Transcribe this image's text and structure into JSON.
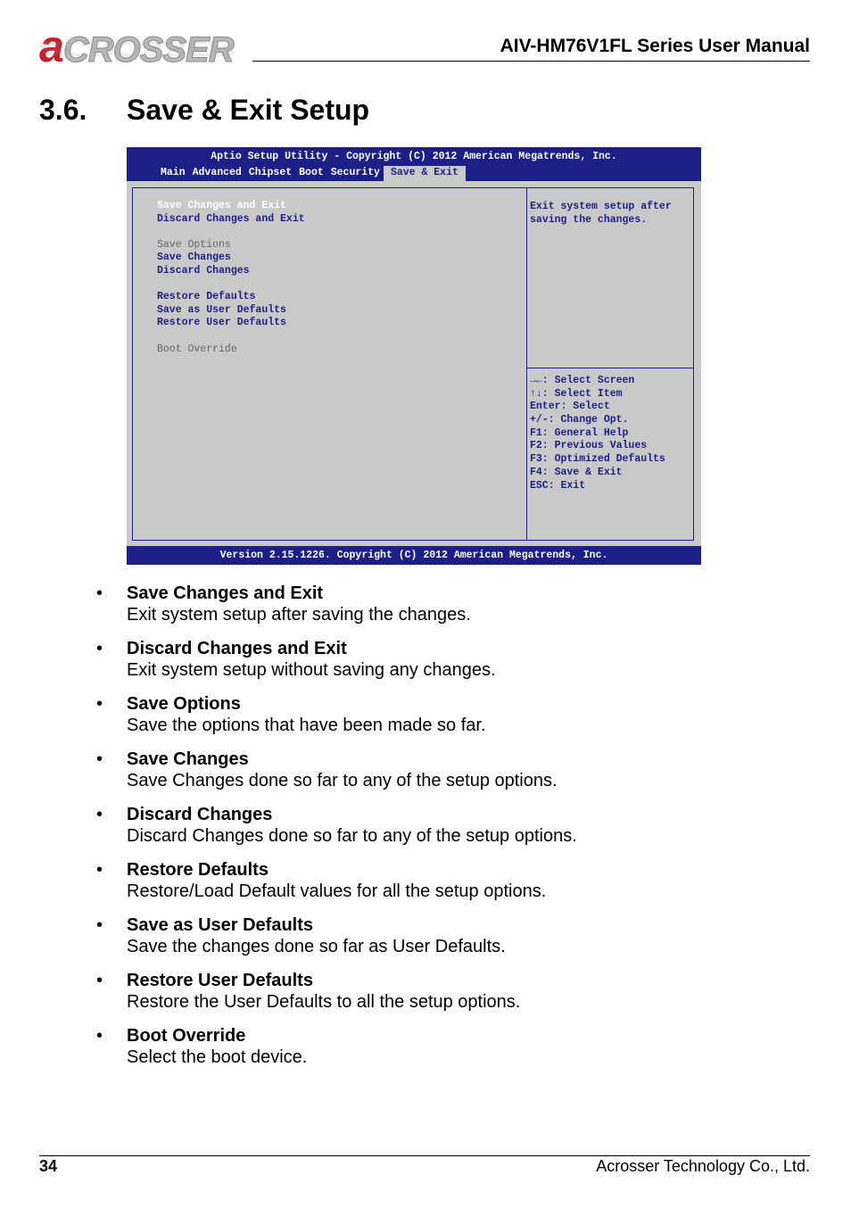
{
  "header": {
    "logo_initial": "a",
    "logo_rest": "CROSSER",
    "title": "AIV-HM76V1FL Series User Manual"
  },
  "section": {
    "number": "3.6.",
    "title": "Save & Exit Setup"
  },
  "bios": {
    "top_title": "Aptio Setup Utility - Copyright (C) 2012 American Megatrends, Inc.",
    "tabs": [
      {
        "label": "Main",
        "active": false
      },
      {
        "label": "Advanced",
        "active": false
      },
      {
        "label": "Chipset",
        "active": false
      },
      {
        "label": "Boot",
        "active": false
      },
      {
        "label": "Security",
        "active": false
      },
      {
        "label": "Save & Exit",
        "active": true
      }
    ],
    "menu": {
      "save_changes_and_exit": "Save Changes and Exit",
      "discard_changes_and_exit": "Discard Changes and Exit",
      "save_options": "Save Options",
      "save_changes": "Save Changes",
      "discard_changes": "Discard Changes",
      "restore_defaults": "Restore Defaults",
      "save_as_user_defaults": "Save as User Defaults",
      "restore_user_defaults": "Restore User Defaults",
      "boot_override": "Boot Override"
    },
    "help_text": "Exit system setup after\nsaving the changes.",
    "keys": [
      "→←: Select Screen",
      "↑↓: Select Item",
      "Enter: Select",
      "+/-: Change Opt.",
      "F1: General Help",
      "F2: Previous Values",
      "F3: Optimized Defaults",
      "F4: Save & Exit",
      "ESC: Exit"
    ],
    "bottom_text": "Version 2.15.1226. Copyright (C) 2012 American Megatrends, Inc.",
    "colors": {
      "bar": "#1c1f86",
      "panel": "#c9c9c9",
      "text": "#1c1f86",
      "selected": "#ffffff",
      "group": "#666666"
    }
  },
  "items": [
    {
      "bullet": "•",
      "title": "Save Changes and Exit",
      "desc": "Exit system setup after saving the changes."
    },
    {
      "bullet": "•",
      "title": "Discard Changes and Exit",
      "desc": "Exit system setup without saving any changes."
    },
    {
      "bullet": "•",
      "title": "Save Options",
      "desc": "Save the options that have been made so far."
    },
    {
      "bullet": "•",
      "title": "Save Changes",
      "desc": "Save Changes done so far to any of the setup options."
    },
    {
      "bullet": "•",
      "title": "Discard Changes",
      "desc": "Discard Changes done so far to any of the setup options."
    },
    {
      "bullet": "•",
      "title": "Restore Defaults",
      "desc": "Restore/Load Default values for all the setup options."
    },
    {
      "bullet": "•",
      "title": "Save as User Defaults",
      "desc": "Save the changes done so far as User Defaults."
    },
    {
      "bullet": "•",
      "title": "Restore User Defaults",
      "desc": "Restore the User Defaults to all the setup options."
    },
    {
      "bullet": "•",
      "title": "Boot Override",
      "desc": "Select the boot device."
    }
  ],
  "footer": {
    "page_number": "34",
    "company": "Acrosser Technology Co., Ltd."
  }
}
